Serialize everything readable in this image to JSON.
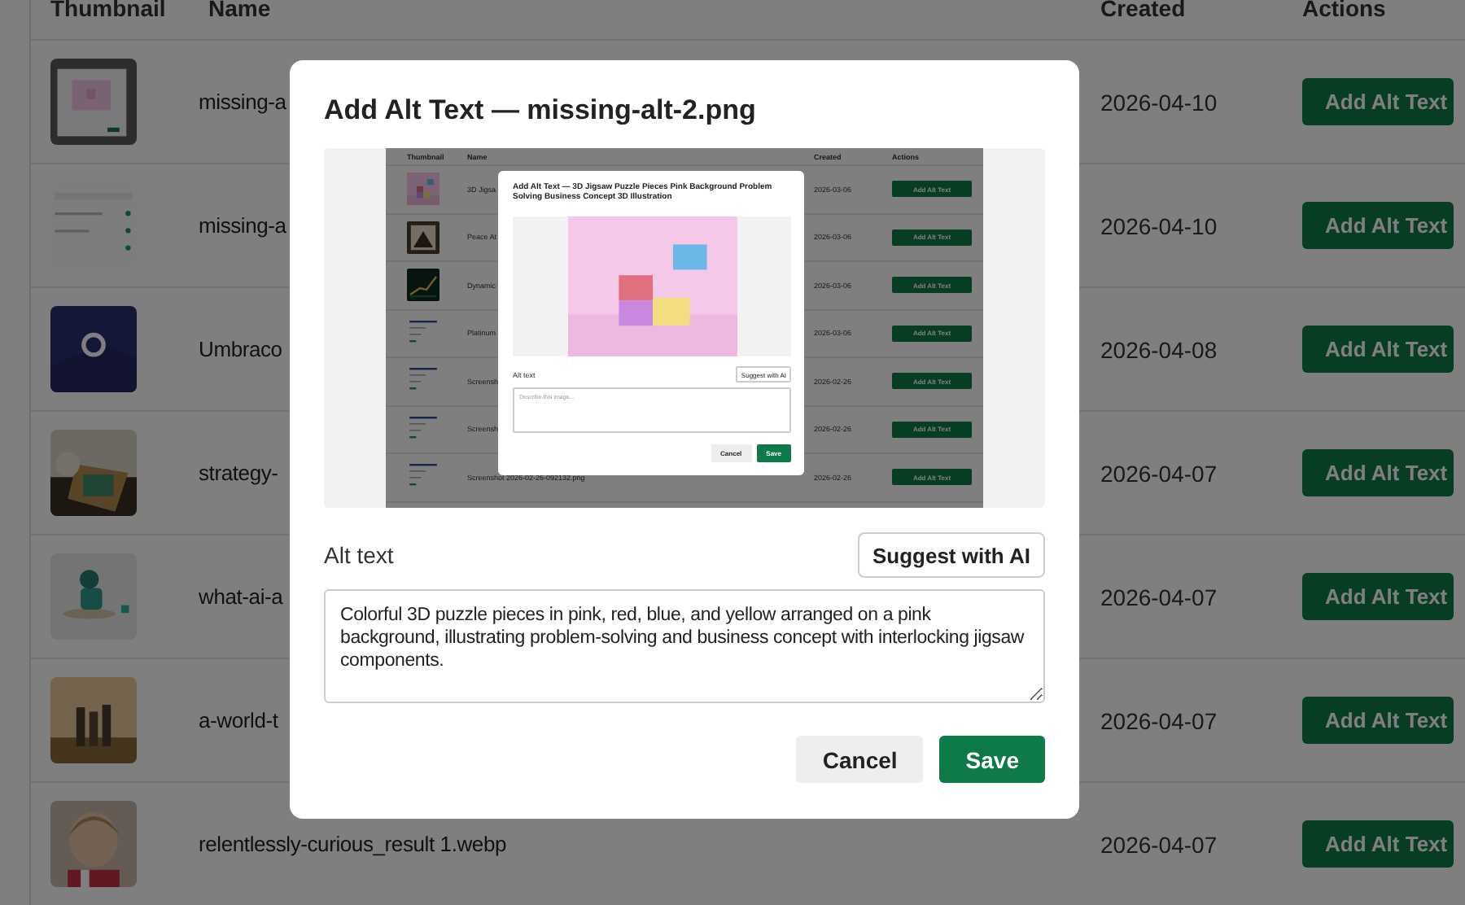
{
  "table": {
    "columns": [
      "Thumbnail",
      "Name",
      "Created",
      "Actions"
    ],
    "rows": [
      {
        "name": "missing-a",
        "created": "2026-04-10",
        "action": "Add Alt Text"
      },
      {
        "name": "missing-a",
        "created": "2026-04-10",
        "action": "Add Alt Text"
      },
      {
        "name": "Umbraco",
        "created": "2026-04-08",
        "action": "Add Alt Text"
      },
      {
        "name": "strategy-",
        "created": "2026-04-07",
        "action": "Add Alt Text"
      },
      {
        "name": "what-ai-a",
        "created": "2026-04-07",
        "action": "Add Alt Text"
      },
      {
        "name": "a-world-t",
        "created": "2026-04-07",
        "action": "Add Alt Text"
      },
      {
        "name": "relentlessly-curious_result 1.webp",
        "created": "2026-04-07",
        "action": "Add Alt Text"
      }
    ]
  },
  "dialog": {
    "title": "Add Alt Text — missing-alt-2.png",
    "preview": {
      "table": {
        "columns": [
          "Thumbnail",
          "Name",
          "Created",
          "Actions"
        ],
        "rows": [
          {
            "name": "3D Jigsa",
            "created": "2026-03-06",
            "action": "Add Alt Text"
          },
          {
            "name": "Peace At",
            "created": "2026-03-06",
            "action": "Add Alt Text"
          },
          {
            "name": "Dynamic",
            "created": "2026-03-06",
            "action": "Add Alt Text"
          },
          {
            "name": "Platinum",
            "created": "2026-03-06",
            "action": "Add Alt Text"
          },
          {
            "name": "Screensh",
            "created": "2026-02-26",
            "action": "Add Alt Text"
          },
          {
            "name": "Screensh",
            "created": "2026-02-26",
            "action": "Add Alt Text"
          },
          {
            "name": "Screenshot 2026-02-26-092132.png",
            "created": "2026-02-26",
            "action": "Add Alt Text"
          }
        ]
      },
      "dialog": {
        "title": "Add Alt Text — 3D Jigsaw Puzzle Pieces Pink Background Problem Solving Business Concept 3D Illustration",
        "alt_label": "Alt text",
        "suggest_button": "Suggest with AI",
        "placeholder": "Describe this image...",
        "cancel": "Cancel",
        "save": "Save"
      }
    },
    "alt_label": "Alt text",
    "suggest_button": "Suggest with AI",
    "alt_text": "Colorful 3D puzzle pieces in pink, red, blue, and yellow arranged on a pink background, illustrating problem-solving and business concept with interlocking jigsaw components.",
    "cancel": "Cancel",
    "save": "Save"
  }
}
